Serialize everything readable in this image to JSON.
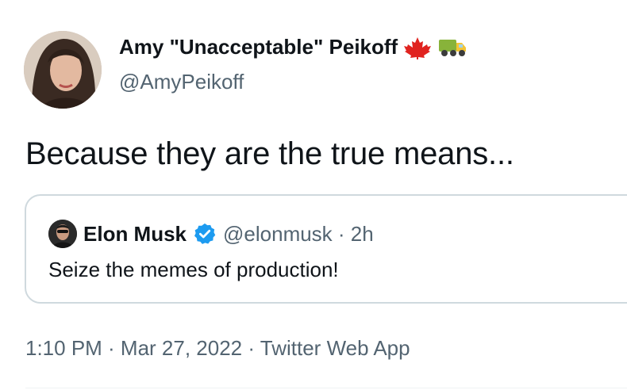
{
  "tweet": {
    "author_name": "Amy \"Unacceptable\" Peikoff",
    "author_emojis": [
      "maple-leaf-icon",
      "truck-icon"
    ],
    "author_handle": "@AmyPeikoff",
    "text": "Because they are the true means...",
    "timestamp": "1:10 PM · Mar 27, 2022 · Twitter Web App"
  },
  "quoted_tweet": {
    "author_name": "Elon Musk",
    "verified": true,
    "handle_and_time": "@elonmusk · 2h",
    "text": "Seize the memes of production!"
  },
  "colors": {
    "text_primary": "#0f1419",
    "text_secondary": "#536471",
    "border": "#cfd9de",
    "verified_blue": "#1d9bf0",
    "maple_red": "#e0231f"
  }
}
